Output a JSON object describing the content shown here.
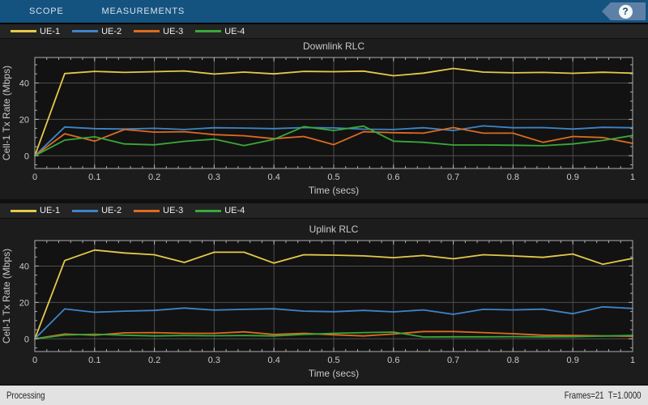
{
  "toolbar": {
    "tabs": [
      {
        "label": "SCOPE"
      },
      {
        "label": "MEASUREMENTS"
      }
    ],
    "help_icon": "?",
    "colors": {
      "bg": "#14527f",
      "help_arrow": "#5d81a6",
      "help_glyph": "#1c4668"
    }
  },
  "status_bar": {
    "left": "Processing",
    "frames": "Frames=21",
    "time": "T=1.0000"
  },
  "chart_style": {
    "bg": "#1c1c1c",
    "plot_bg": "#121212",
    "grid_color": "#4f4f4f",
    "axis_color": "#adadad",
    "label_color": "#c9c9c9",
    "legend_bg": "#242424"
  },
  "chart_data": [
    {
      "type": "line",
      "title": "Downlink RLC",
      "xlabel": "Time (secs)",
      "ylabel": "Cell-1 Tx Rate (Mbps)",
      "xlim": [
        0,
        1
      ],
      "ylim": [
        -7,
        54
      ],
      "grid": true,
      "legend_position": "top-row",
      "xtick_values": [
        0,
        0.1,
        0.2,
        0.3,
        0.4,
        0.5,
        0.6,
        0.7,
        0.8,
        0.9,
        1
      ],
      "xtick_labels": [
        "0",
        "0.1",
        "0.2",
        "0.3",
        "0.4",
        "0.5",
        "0.6",
        "0.7",
        "0.8",
        "0.9",
        "1"
      ],
      "yticks": [
        0,
        20,
        40
      ],
      "x_minor_step": 0.02,
      "y_minor_step": 5,
      "x": [
        0,
        0.05,
        0.1,
        0.15,
        0.2,
        0.25,
        0.3,
        0.35,
        0.4,
        0.45,
        0.5,
        0.55,
        0.6,
        0.65,
        0.7,
        0.75,
        0.8,
        0.85,
        0.9,
        0.95,
        1
      ],
      "series": [
        {
          "name": "UE-1",
          "color": "#e5c94a",
          "values": [
            0,
            45.2,
            46.4,
            45.8,
            46.2,
            46.6,
            44.9,
            46.0,
            45.0,
            46.4,
            46.2,
            46.5,
            44.0,
            45.4,
            48.0,
            46.0,
            45.6,
            45.8,
            45.3,
            45.9,
            45.4
          ]
        },
        {
          "name": "UE-2",
          "color": "#3e84c7",
          "values": [
            0,
            15.8,
            14.9,
            14.7,
            15.1,
            14.4,
            15.4,
            15.2,
            14.9,
            15.5,
            15.3,
            14.6,
            14.4,
            15.4,
            13.9,
            16.4,
            15.4,
            15.5,
            14.7,
            15.6,
            15.4
          ]
        },
        {
          "name": "UE-3",
          "color": "#dd6b20",
          "values": [
            0,
            12.1,
            8.0,
            14.4,
            13.0,
            13.2,
            11.6,
            11.0,
            9.4,
            10.6,
            6.1,
            13.2,
            12.7,
            12.4,
            15.5,
            12.4,
            12.4,
            7.4,
            10.6,
            10.0,
            6.8
          ]
        },
        {
          "name": "UE-4",
          "color": "#3aa83a",
          "values": [
            0,
            8.6,
            10.4,
            6.5,
            6.0,
            7.9,
            9.1,
            5.6,
            9.0,
            16.0,
            13.9,
            16.3,
            8.0,
            7.4,
            5.9,
            5.9,
            5.8,
            5.5,
            6.5,
            8.4,
            11.1
          ]
        }
      ]
    },
    {
      "type": "line",
      "title": "Uplink RLC",
      "xlabel": "Time (secs)",
      "ylabel": "Cell-1 Tx Rate (Mbps)",
      "xlim": [
        0,
        1
      ],
      "ylim": [
        -7,
        54
      ],
      "grid": true,
      "legend_position": "top-row",
      "xtick_values": [
        0,
        0.1,
        0.2,
        0.3,
        0.4,
        0.5,
        0.6,
        0.7,
        0.8,
        0.9,
        1
      ],
      "xtick_labels": [
        "0",
        "0.1",
        "0.2",
        "0.3",
        "0.4",
        "0.5",
        "0.6",
        "0.7",
        "0.8",
        "0.9",
        "1"
      ],
      "yticks": [
        0,
        20,
        40
      ],
      "x_minor_step": 0.02,
      "y_minor_step": 5,
      "x": [
        0,
        0.05,
        0.1,
        0.15,
        0.2,
        0.25,
        0.3,
        0.35,
        0.4,
        0.45,
        0.5,
        0.55,
        0.6,
        0.65,
        0.7,
        0.75,
        0.8,
        0.85,
        0.9,
        0.95,
        1
      ],
      "series": [
        {
          "name": "UE-1",
          "color": "#e5c94a",
          "values": [
            0,
            43.0,
            48.8,
            47.2,
            46.2,
            42.0,
            47.6,
            47.6,
            41.6,
            46.2,
            46.0,
            45.6,
            44.6,
            45.8,
            44.0,
            46.2,
            45.6,
            44.8,
            46.6,
            41.0,
            44.2
          ]
        },
        {
          "name": "UE-2",
          "color": "#3e84c7",
          "values": [
            0,
            16.4,
            14.6,
            15.2,
            15.6,
            16.9,
            15.8,
            16.2,
            16.5,
            15.2,
            14.9,
            15.6,
            14.8,
            15.9,
            13.5,
            16.2,
            15.9,
            16.3,
            13.8,
            17.6,
            16.7
          ]
        },
        {
          "name": "UE-3",
          "color": "#dd6b20",
          "values": [
            0,
            2.6,
            2.0,
            3.3,
            3.4,
            3.0,
            3.0,
            3.8,
            2.4,
            3.0,
            2.2,
            1.6,
            2.6,
            4.0,
            4.0,
            3.4,
            2.8,
            2.0,
            1.8,
            1.6,
            1.4
          ]
        },
        {
          "name": "UE-4",
          "color": "#3aa83a",
          "values": [
            0,
            2.1,
            2.5,
            2.0,
            1.6,
            1.8,
            1.7,
            1.8,
            1.6,
            2.4,
            3.0,
            3.4,
            3.7,
            1.0,
            1.1,
            1.1,
            1.2,
            1.1,
            1.2,
            1.5,
            1.9
          ]
        }
      ]
    }
  ]
}
